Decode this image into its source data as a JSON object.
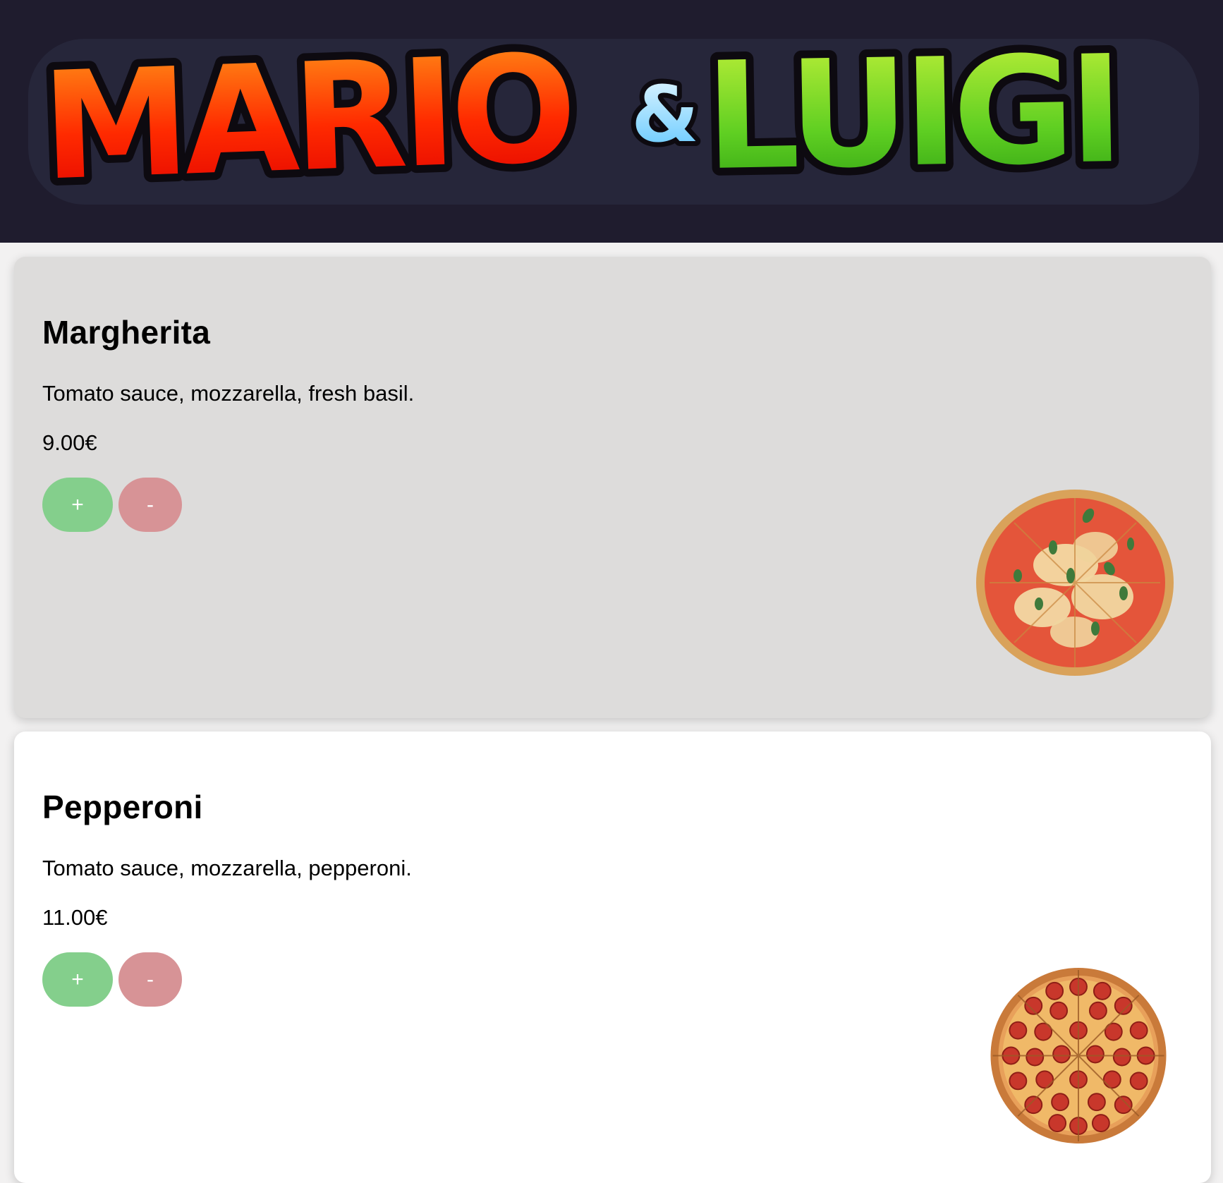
{
  "header": {
    "logo": {
      "word_left": "MARIO",
      "ampersand": "&",
      "word_right": "LUIGI"
    },
    "background_color": "#1f1c2e"
  },
  "menu": {
    "items": [
      {
        "name": "Margherita",
        "description": "Tomato sauce, mozzarella, fresh basil.",
        "price": "9.00€",
        "add_label": "+",
        "remove_label": "-",
        "image": "margherita-pizza"
      },
      {
        "name": "Pepperoni",
        "description": "Tomato sauce, mozzarella, pepperoni.",
        "price": "11.00€",
        "add_label": "+",
        "remove_label": "-",
        "image": "pepperoni-pizza"
      }
    ]
  },
  "colors": {
    "add_button": "#84cf8c",
    "remove_button": "#d79396",
    "card_hover": "#dddcdb",
    "card": "#ffffff"
  }
}
